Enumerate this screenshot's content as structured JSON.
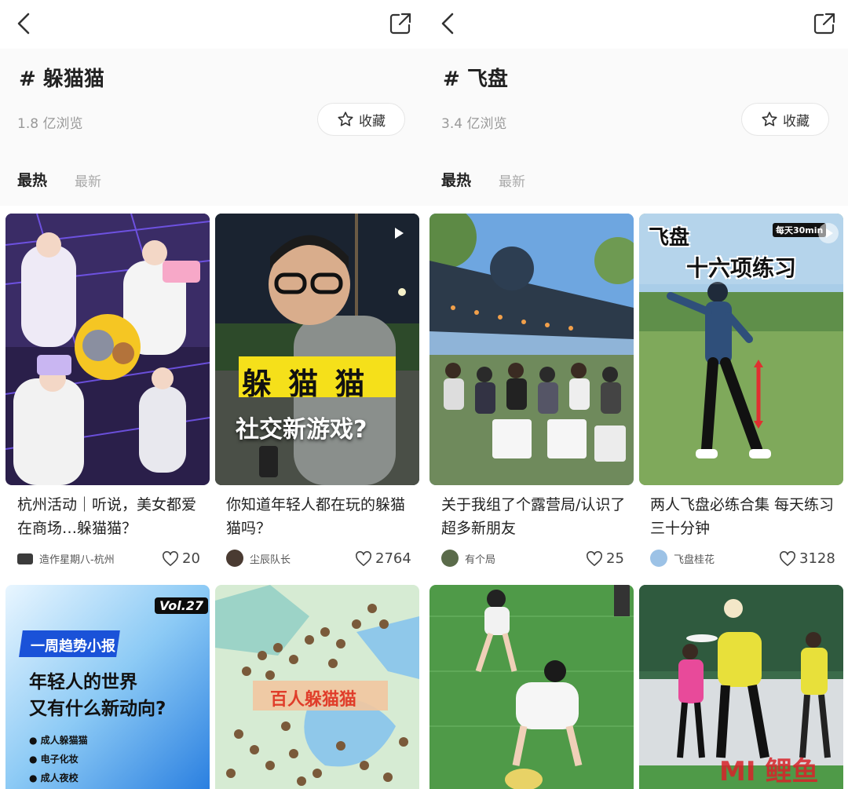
{
  "left": {
    "tag_title": "# 躲猫猫",
    "views": "1.8 亿浏览",
    "favorite_label": "收藏",
    "tab_hot": "最热",
    "tab_new": "最新",
    "cards": [
      {
        "title": "杭州活动｜听说，美女都爱在商场…躲猫猫？",
        "author": "造作星期八-杭州",
        "likes": "20"
      },
      {
        "title": "你知道年轻人都在玩的躲猫猫吗？",
        "author": "尘辰队长",
        "likes": "2764",
        "overlay_main": "躲 猫 猫",
        "overlay_sub": "社交新游戏?"
      }
    ],
    "bottom_cards": [
      {
        "vol": "Vol.27",
        "badge": "一周趋势小报",
        "headline_1": "年轻人的世界",
        "headline_2": "又有什么新动向?",
        "bullets": [
          "成人躲猫猫",
          "电子化妆",
          "成人夜校"
        ]
      },
      {
        "map_label": "百人躲猫猫"
      }
    ]
  },
  "right": {
    "tag_title": "# 飞盘",
    "views": "3.4 亿浏览",
    "favorite_label": "收藏",
    "tab_hot": "最热",
    "tab_new": "最新",
    "cards": [
      {
        "title": "关于我组了个露营局/认识了超多新朋友",
        "author": "有个局",
        "likes": "25"
      },
      {
        "title": "两人飞盘必练合集 每天练习三十分钟",
        "author": "飞盘桂花",
        "likes": "3128",
        "overlay_main": "飞盘",
        "overlay_sub": "十六项练习",
        "overlay_tag": "每天30min"
      }
    ]
  },
  "watermark": "MI 鲤鱼",
  "colors": {
    "accent_yellow": "#f5e01a",
    "brand_red": "#d8232a",
    "text_grey": "#999999"
  }
}
